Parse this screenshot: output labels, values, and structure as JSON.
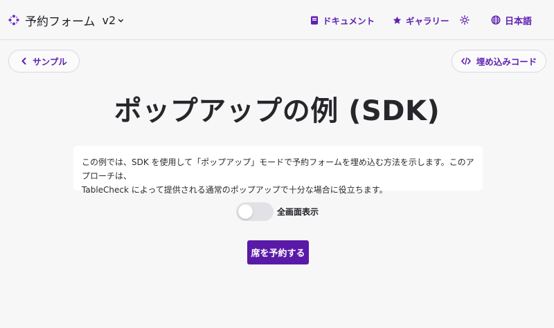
{
  "header": {
    "brand_title": "予約フォーム",
    "version": "v2",
    "nav": {
      "docs": "ドキュメント",
      "gallery": "ギャラリー",
      "language": "日本語"
    }
  },
  "toolbar": {
    "back_label": "サンプル",
    "embed_label": "埋め込みコード"
  },
  "main": {
    "title": "ポップアップの例 (SDK)",
    "description_line1": "この例では、SDK を使用して「ポップアップ」モードで予約フォームを埋め込む方法を示します。このアプローチは、",
    "description_line2": "TableCheck によって提供される通常のポップアップで十分な場合に役立ちます。",
    "fullscreen_label": "全画面表示",
    "fullscreen_on": false,
    "reserve_button": "席を予約する"
  },
  "colors": {
    "accent": "#5f1fb0",
    "button": "#5a1aa8",
    "background": "#f7f7f8"
  },
  "icons": [
    "brand-logo-icon",
    "chevron-down-icon",
    "book-icon",
    "star-icon",
    "sun-icon",
    "globe-icon",
    "chevron-left-icon",
    "code-icon"
  ]
}
